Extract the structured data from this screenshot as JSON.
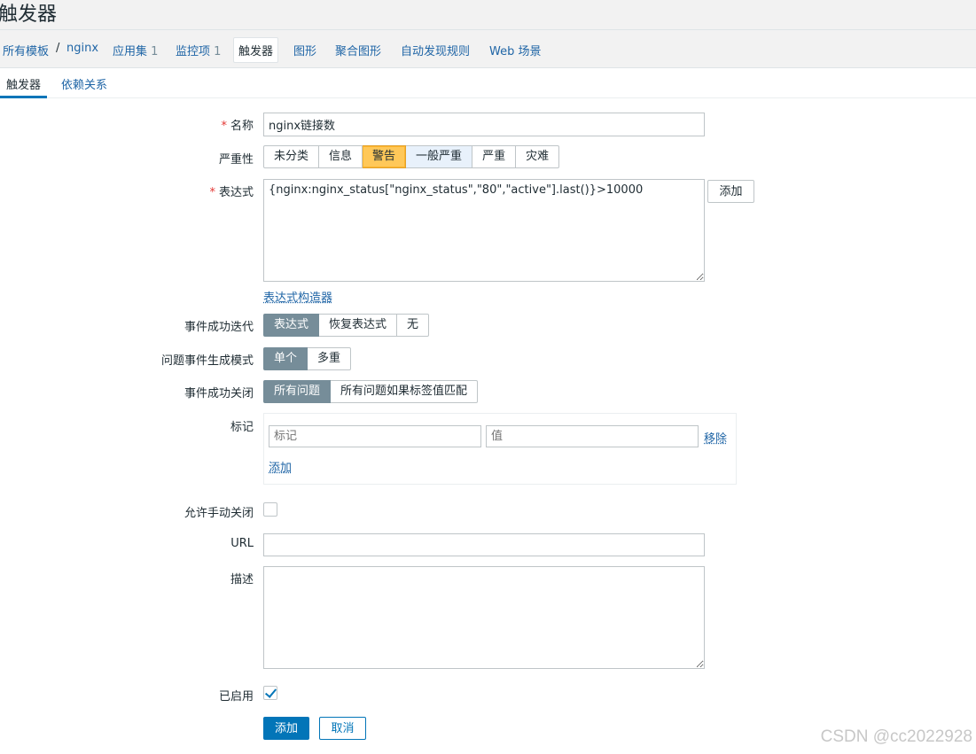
{
  "header": {
    "title": "触发器"
  },
  "breadcrumb": {
    "all_templates": "所有模板",
    "separator": "/",
    "template": "nginx",
    "applications": "应用集",
    "applications_count": "1",
    "items": "监控项",
    "items_count": "1",
    "triggers": "触发器",
    "graphs": "图形",
    "screens": "聚合图形",
    "discovery": "自动发现规则",
    "web": "Web 场景"
  },
  "tabs": [
    "触发器",
    "依赖关系"
  ],
  "form": {
    "name_label": "名称",
    "name_value": "nginx链接数",
    "severity_label": "严重性",
    "severity_options": [
      "未分类",
      "信息",
      "警告",
      "一般严重",
      "严重",
      "灾难"
    ],
    "severity_selected": "警告",
    "expression_label": "表达式",
    "expression_value": "{nginx:nginx_status[\"nginx_status\",\"80\",\"active\"].last()}>10000",
    "expression_add": "添加",
    "expression_builder": "表达式构造器",
    "ok_event_label": "事件成功迭代",
    "ok_event_options": [
      "表达式",
      "恢复表达式",
      "无"
    ],
    "ok_event_selected": "表达式",
    "problem_mode_label": "问题事件生成模式",
    "problem_mode_options": [
      "单个",
      "多重"
    ],
    "problem_mode_selected": "单个",
    "ok_close_label": "事件成功关闭",
    "ok_close_options": [
      "所有问题",
      "所有问题如果标签值匹配"
    ],
    "ok_close_selected": "所有问题",
    "tags_label": "标记",
    "tag_placeholder": "标记",
    "value_placeholder": "值",
    "tag_remove": "移除",
    "tag_add": "添加",
    "manual_close_label": "允许手动关闭",
    "manual_close_checked": false,
    "url_label": "URL",
    "url_value": "",
    "description_label": "描述",
    "description_value": "",
    "enabled_label": "已启用",
    "enabled_checked": true,
    "submit": "添加",
    "cancel": "取消",
    "required_mark": "*"
  },
  "watermark": "CSDN @cc2022928"
}
